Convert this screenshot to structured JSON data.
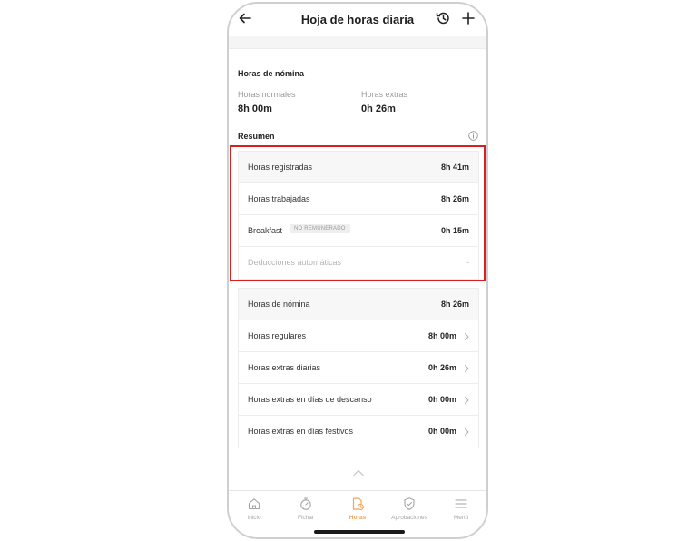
{
  "header": {
    "title": "Hoja de horas diaria",
    "back_icon": "arrow-left-icon",
    "history_icon": "history-icon",
    "add_icon": "plus-icon"
  },
  "payroll_hours": {
    "section_title": "Horas de nómina",
    "normal_label": "Horas normales",
    "normal_value": "8h 00m",
    "extra_label": "Horas extras",
    "extra_value": "0h 26m"
  },
  "summary": {
    "section_title": "Resumen",
    "info_icon": "info-icon",
    "rows": [
      {
        "label": "Horas registradas",
        "value": "8h 41m"
      },
      {
        "label": "Horas trabajadas",
        "value": "8h 26m"
      },
      {
        "label": "Breakfast",
        "badge": "NO REMUNERADO",
        "value": "0h 15m"
      },
      {
        "label": "Deducciones automáticas",
        "value": "-"
      }
    ]
  },
  "payroll_breakdown": {
    "rows": [
      {
        "label": "Horas de nómina",
        "value": "8h 26m"
      },
      {
        "label": "Horas regulares",
        "value": "8h 00m"
      },
      {
        "label": "Horas extras diarias",
        "value": "0h 26m"
      },
      {
        "label": "Horas extras en días de descanso",
        "value": "0h 00m"
      },
      {
        "label": "Horas extras en días festivos",
        "value": "0h 00m"
      }
    ]
  },
  "tabbar": {
    "items": [
      {
        "label": "Inicio",
        "icon": "home-icon"
      },
      {
        "label": "Fichar",
        "icon": "stopwatch-icon"
      },
      {
        "label": "Horas",
        "icon": "timesheet-icon",
        "active": true
      },
      {
        "label": "Aprobaciones",
        "icon": "shield-check-icon"
      },
      {
        "label": "Menú",
        "icon": "menu-icon"
      }
    ]
  },
  "colors": {
    "accent": "#f2a55b",
    "highlight": "#d9201f"
  }
}
